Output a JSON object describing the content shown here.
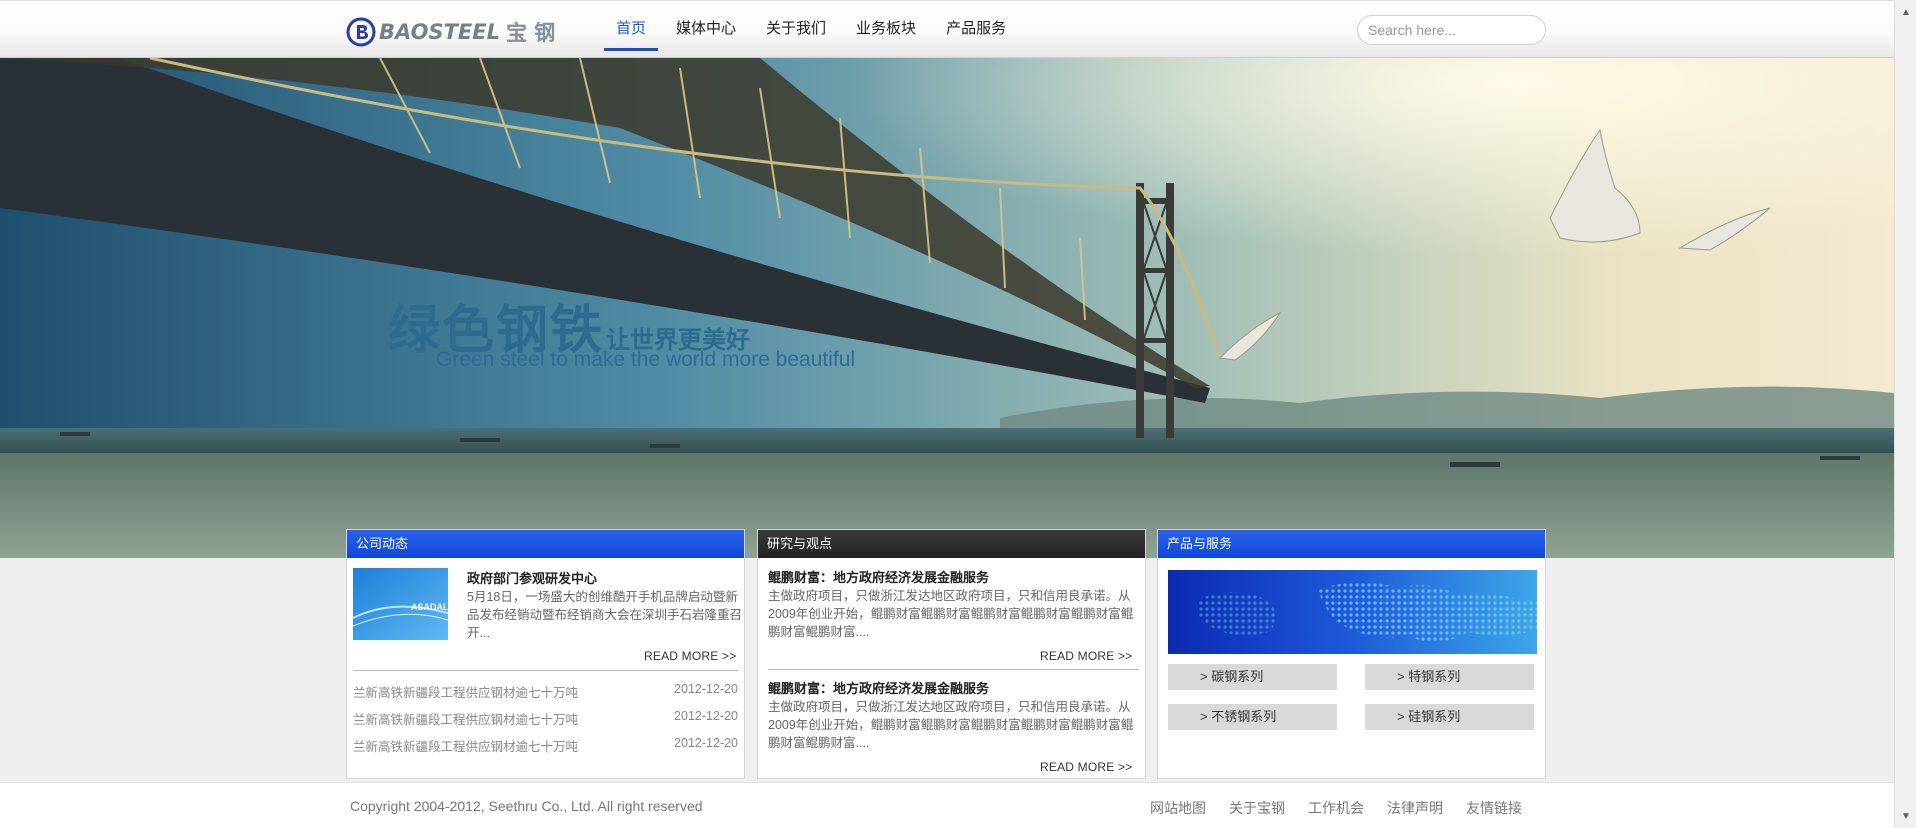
{
  "header": {
    "logo_text": "BAOSTEEL",
    "logo_cn": "宝 钢",
    "nav": [
      "首页",
      "媒体中心",
      "关于我们",
      "业务板块",
      "产品服务"
    ],
    "search_placeholder": "Search here..."
  },
  "banner": {
    "slogan_cn_big": "绿色钢铁",
    "slogan_cn_small": "让世界更美好",
    "slogan_en": "Green steel to make the world more beautiful"
  },
  "company_news": {
    "title": "公司动态",
    "feature": {
      "title": "政府部门参观研发中心",
      "body": "5月18日，一场盛大的创维酷开手机品牌启动暨新品发布经销动暨布经销商大会在深圳手石岩隆重召开...",
      "thumb_text": "ASADAL",
      "read_more": "READ MORE >>"
    },
    "items": [
      {
        "title": "兰新高铁新疆段工程供应钢材逾七十万吨",
        "date": "2012-12-20"
      },
      {
        "title": "兰新高铁新疆段工程供应钢材逾七十万吨",
        "date": "2012-12-20"
      },
      {
        "title": "兰新高铁新疆段工程供应钢材逾七十万吨",
        "date": "2012-12-20"
      }
    ]
  },
  "research": {
    "title": "研究与观点",
    "articles": [
      {
        "title": "鲲鹏财富：地方政府经济发展金融服务",
        "body": "主做政府项目，只做浙江发达地区政府项目，只和信用良承诺。从2009年创业开始，鲲鹏财富鲲鹏财富鲲鹏财富鲲鹏财富鲲鹏财富鲲鹏财富鲲鹏财富....",
        "read_more": "READ MORE >>"
      },
      {
        "title": "鲲鹏财富：地方政府经济发展金融服务",
        "body": "主做政府项目，只做浙江发达地区政府项目，只和信用良承诺。从2009年创业开始，鲲鹏财富鲲鹏财富鲲鹏财富鲲鹏财富鲲鹏财富鲲鹏财富鲲鹏财富....",
        "read_more": "READ MORE >>"
      }
    ]
  },
  "products": {
    "title": "产品与服务",
    "buttons": [
      "> 碳钢系列",
      "> 特钢系列",
      "> 不锈钢系列",
      "> 硅钢系列"
    ]
  },
  "footer": {
    "copyright": "Copyright 2004-2012, Seethru Co., Ltd. All right reserved",
    "links": [
      "网站地图",
      "关于宝钢",
      "工作机会",
      "法律声明",
      "友情链接"
    ]
  },
  "colors": {
    "accent": "#1a4fd0",
    "panel_header_blue": "#1a52e0",
    "panel_header_dark": "#2a2a2a"
  }
}
